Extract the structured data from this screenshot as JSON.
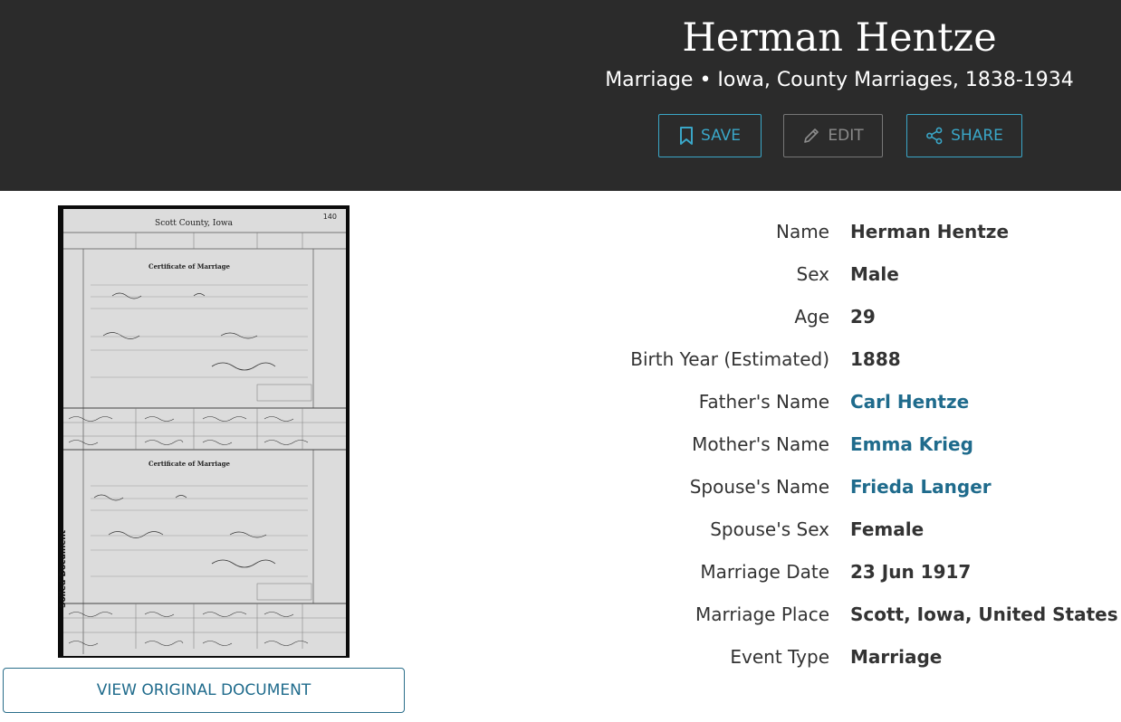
{
  "header": {
    "title": "Herman Hentze",
    "subtitle": "Marriage • Iowa, County Marriages, 1838-1934",
    "buttons": {
      "save": "SAVE",
      "edit": "EDIT",
      "share": "SHARE"
    }
  },
  "document": {
    "county_heading": "Scott County, Iowa",
    "page_number": "140",
    "certificate_heading": "Certificate of Marriage",
    "side_stamp": "Soiled Document",
    "view_button": "VIEW ORIGINAL DOCUMENT"
  },
  "facts": [
    {
      "label": "Name",
      "value": "Herman Hentze",
      "link": false
    },
    {
      "label": "Sex",
      "value": "Male",
      "link": false
    },
    {
      "label": "Age",
      "value": "29",
      "link": false
    },
    {
      "label": "Birth Year (Estimated)",
      "value": "1888",
      "link": false
    },
    {
      "label": "Father's Name",
      "value": "Carl Hentze",
      "link": true
    },
    {
      "label": "Mother's Name",
      "value": "Emma Krieg",
      "link": true
    },
    {
      "label": "Spouse's Name",
      "value": "Frieda Langer",
      "link": true
    },
    {
      "label": "Spouse's Sex",
      "value": "Female",
      "link": false
    },
    {
      "label": "Marriage Date",
      "value": "23 Jun 1917",
      "link": false
    },
    {
      "label": "Marriage Place",
      "value": "Scott, Iowa, United States",
      "link": false
    },
    {
      "label": "Event Type",
      "value": "Marriage",
      "link": false
    }
  ],
  "colors": {
    "header_bg": "#2b2b2b",
    "accent": "#3aa6c7",
    "link": "#1f6b8c"
  },
  "icons": {
    "save": "bookmark-icon",
    "edit": "pencil-icon",
    "share": "share-icon"
  }
}
